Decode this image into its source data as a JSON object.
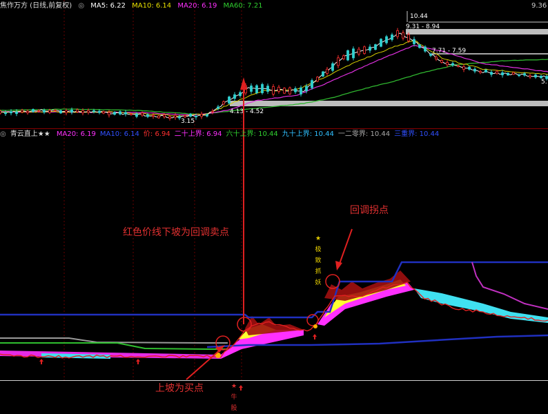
{
  "top_panel": {
    "title": "焦作万方 (日线,前复权)",
    "ma": [
      {
        "label": "MA5: 6.22",
        "color": "#ffffff"
      },
      {
        "label": "MA10: 6.14",
        "color": "#e8e000"
      },
      {
        "label": "MA20: 6.19",
        "color": "#ff30ff"
      },
      {
        "label": "MA60: 7.21",
        "color": "#30d030"
      }
    ],
    "price_labels": {
      "high": "10.44",
      "band_upper": "9.31 - 8.94",
      "band_mid": "7.71 - 7.59",
      "band_low": "4.13 - 4.52",
      "low": "3.15",
      "right_edge": "5.",
      "tick_top": "9.36"
    }
  },
  "bottom_panel": {
    "title": "青云直上★★",
    "fields": [
      {
        "label": "MA20: 6.19",
        "color": "#ff30ff"
      },
      {
        "label": "MA10: 6.14",
        "color": "#3050ff"
      },
      {
        "label": "价: 6.94",
        "color": "#ff3030"
      },
      {
        "label": "二十上界: 6.94",
        "color": "#ff30ff"
      },
      {
        "label": "六十上界: 10.44",
        "color": "#30d030"
      },
      {
        "label": "九十上界: 10.44",
        "color": "#30c0ff"
      },
      {
        "label": "一二零界: 10.44",
        "color": "#aaaaaa"
      },
      {
        "label": "三重界: 10.44",
        "color": "#3050ff"
      }
    ],
    "annotations": {
      "sell_point": "红色价线下坡为回调卖点",
      "turn_point": "回调拐点",
      "buy_point": "上坡为买点",
      "vertical_signal": "★极致抓妖",
      "vertical_signal_low": "★牛股"
    }
  },
  "chart_data": [
    {
      "type": "candlestick",
      "title": "焦作万方 (日线,前复权)",
      "series": [
        {
          "name": "MA5",
          "color": "#ffffff"
        },
        {
          "name": "MA10",
          "color": "#e8e000"
        },
        {
          "name": "MA20",
          "color": "#ff30ff"
        },
        {
          "name": "MA60",
          "color": "#30d030"
        }
      ],
      "annotations": [
        "10.44",
        "9.31 - 8.94",
        "7.71 - 7.59",
        "4.13 - 4.52",
        "3.15"
      ]
    },
    {
      "type": "line",
      "title": "青云直上★★",
      "series": [
        {
          "name": "价",
          "color": "#ff3030"
        },
        {
          "name": "二十上界",
          "color": "#ff30ff"
        },
        {
          "name": "六十上界",
          "color": "#30d030"
        },
        {
          "name": "九十上界",
          "color": "#30c0ff"
        },
        {
          "name": "一二零界",
          "color": "#aaaaaa"
        },
        {
          "name": "三重界",
          "color": "#3050ff"
        }
      ]
    }
  ]
}
